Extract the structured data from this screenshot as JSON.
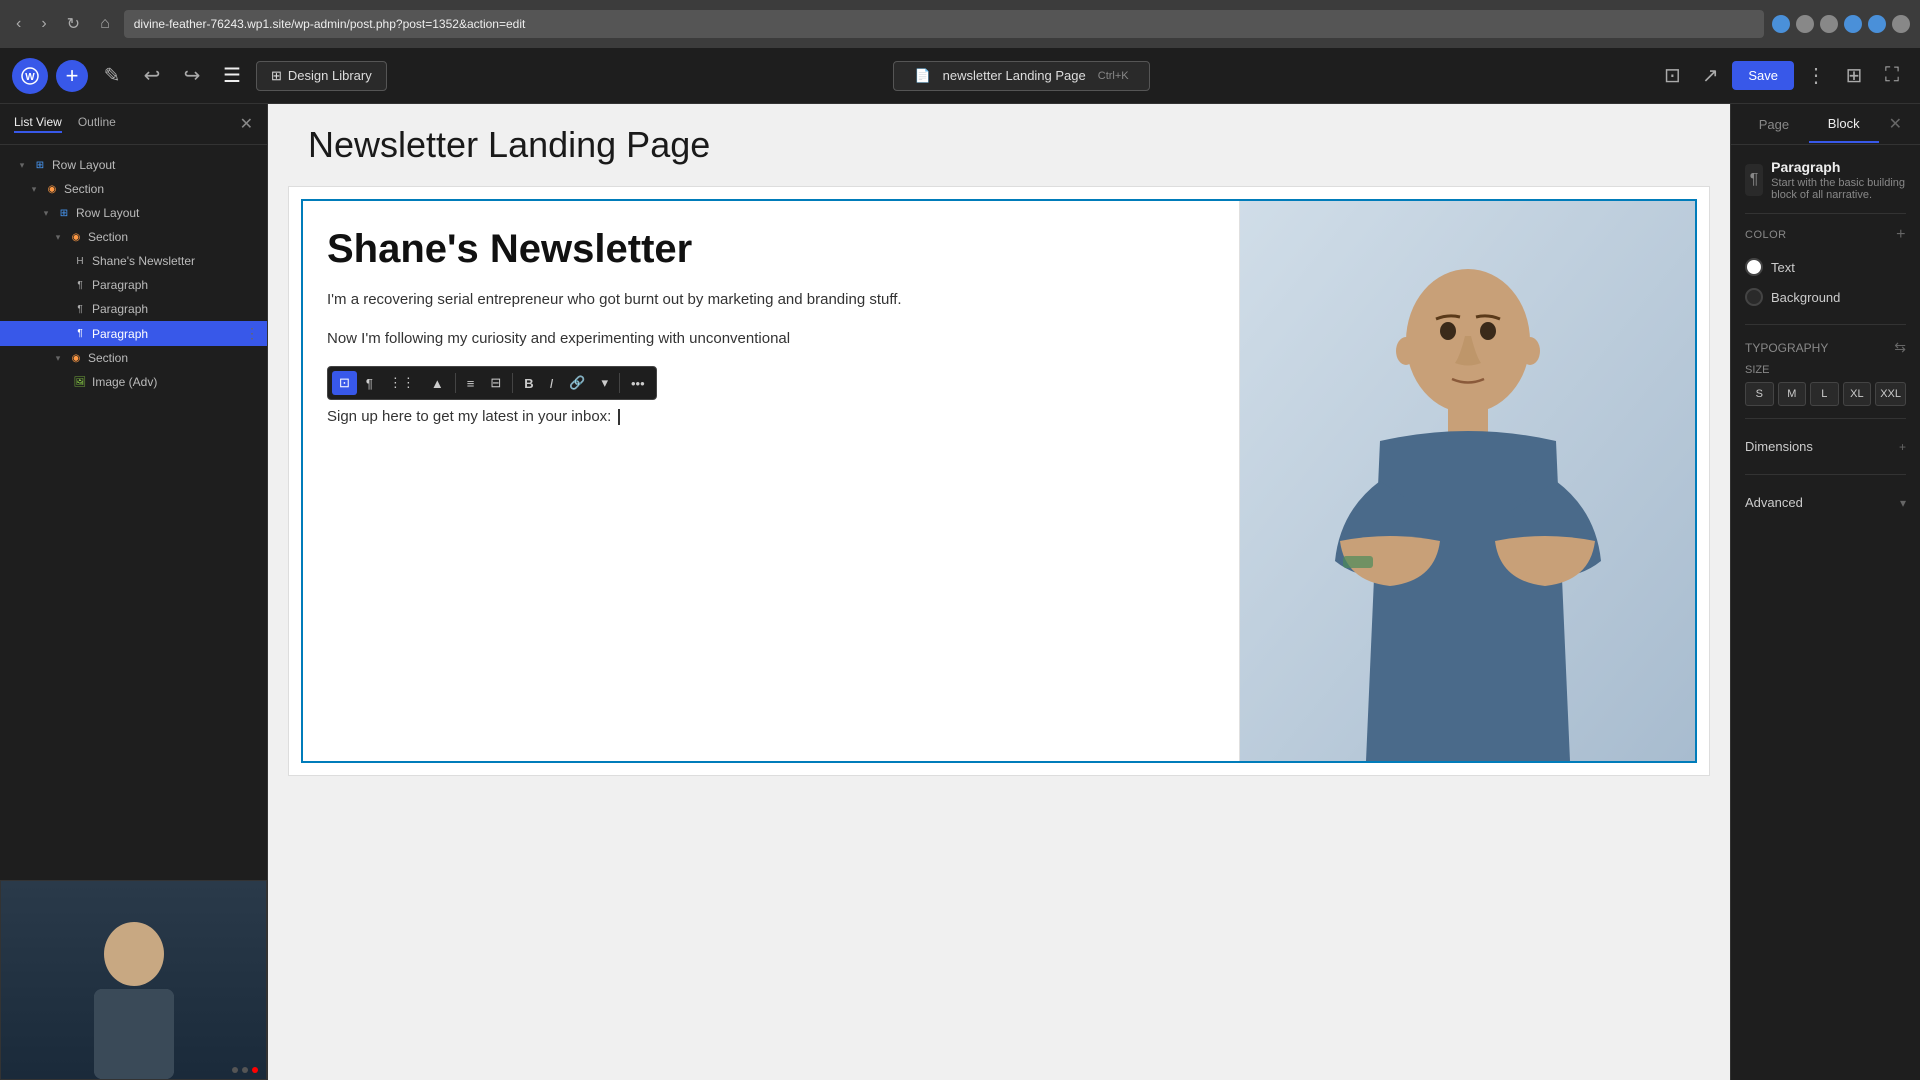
{
  "browser": {
    "url": "divine-feather-76243.wp1.site/wp-admin/post.php?post=1352&action=edit",
    "nav_back": "‹",
    "nav_forward": "›",
    "refresh": "↻",
    "home": "⌂"
  },
  "toolbar": {
    "wp_logo": "W",
    "add_btn": "+",
    "edit_btn": "✎",
    "undo": "↩",
    "redo": "↪",
    "list_view": "☰",
    "design_library": "Design Library",
    "page_label": "newsletter Landing Page",
    "keyboard_shortcut": "Ctrl+K",
    "save_btn": "Save"
  },
  "left_panel": {
    "tab1": "List View",
    "tab2": "Outline",
    "close": "✕",
    "tree": [
      {
        "id": 1,
        "label": "Row Layout",
        "type": "row",
        "level": 0,
        "expanded": true,
        "chevron": "▾"
      },
      {
        "id": 2,
        "label": "Section",
        "type": "section",
        "level": 1,
        "expanded": true,
        "chevron": "▾"
      },
      {
        "id": 3,
        "label": "Row Layout",
        "type": "row",
        "level": 2,
        "expanded": true,
        "chevron": "▾"
      },
      {
        "id": 4,
        "label": "Section",
        "type": "section",
        "level": 3,
        "expanded": true,
        "chevron": "▾"
      },
      {
        "id": 5,
        "label": "Shane's Newsletter",
        "type": "block",
        "level": 4
      },
      {
        "id": 6,
        "label": "Paragraph",
        "type": "block",
        "level": 4
      },
      {
        "id": 7,
        "label": "Paragraph",
        "type": "block",
        "level": 4
      },
      {
        "id": 8,
        "label": "Paragraph",
        "type": "block",
        "level": 4,
        "selected": true
      },
      {
        "id": 9,
        "label": "Section",
        "type": "section",
        "level": 3,
        "expanded": true,
        "chevron": "▾"
      },
      {
        "id": 10,
        "label": "Image (Adv)",
        "type": "image",
        "level": 4
      }
    ]
  },
  "canvas": {
    "page_heading": "Newsletter Landing Page",
    "newsletter_title": "Shane's Newsletter",
    "paragraph1": "I'm a recovering serial entrepreneur who got burnt out by marketing and branding stuff.",
    "paragraph2": "Now I'm following my curiosity and experimenting with unconventional",
    "paragraph3": "Sign up here to get my latest in your inbox:"
  },
  "block_toolbar": {
    "items": [
      "¶",
      "⋮⋮",
      "▲",
      "≡",
      "⊟",
      "B",
      "I",
      "🔗",
      "▾",
      "•••"
    ]
  },
  "right_panel": {
    "tab_page": "Page",
    "tab_block": "Block",
    "active_tab": "Block",
    "close": "✕",
    "block_type": "Paragraph",
    "block_desc": "Start with the basic building block of all narrative.",
    "color_section": "Color",
    "color_add": "+",
    "text_label": "Text",
    "background_label": "Background",
    "typography_section": "Typography",
    "size_section": "SIZE",
    "sizes": [
      "S",
      "M",
      "L",
      "XL",
      "XXL"
    ],
    "dimensions_section": "Dimensions",
    "dimensions_add": "+",
    "advanced_section": "Advanced",
    "advanced_arrow": "▾"
  }
}
